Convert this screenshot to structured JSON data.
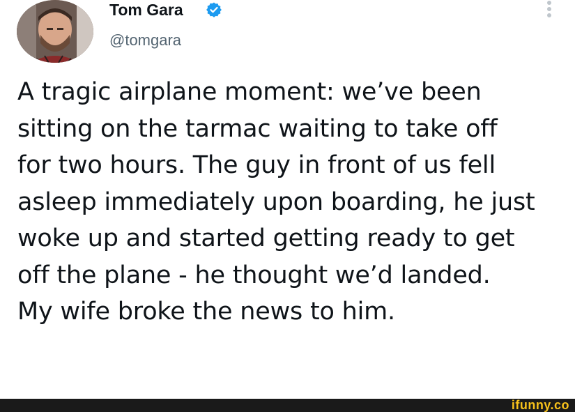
{
  "tweet": {
    "author": {
      "display_name": "Tom Gara",
      "handle": "@tomgara",
      "verified": true,
      "verified_icon": "verified-badge-icon",
      "avatar_icon": "profile-photo"
    },
    "more_icon": "more-options-icon",
    "text": "A tragic airplane moment: we’ve been\nsitting on the tarmac waiting to take off\nfor two hours. The guy in front of us fell\nasleep immediately upon boarding, he just\nwoke up and started getting ready to get\noff the plane - he thought we’d landed.\nMy wife broke the news to him."
  },
  "watermark": {
    "text": "ifunny.co"
  },
  "colors": {
    "verified_blue": "#1d9bf0",
    "text_primary": "#0f1419",
    "text_secondary": "#536471",
    "watermark_bg": "#1a1a1a",
    "watermark_fg": "#f8c21b"
  }
}
